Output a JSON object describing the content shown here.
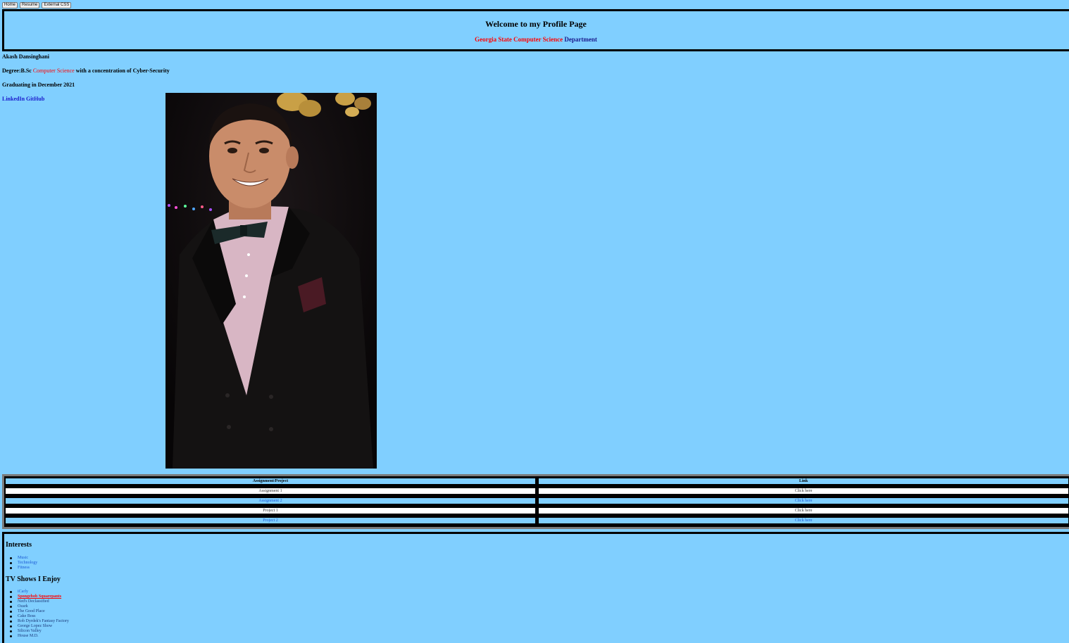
{
  "nav": {
    "home": "Home",
    "resume": "Resume",
    "external_css": "External CSS"
  },
  "header": {
    "title": "Welcome to my Profile Page",
    "dept_red": "Georgia State Computer Science",
    "dept_navy": "Department"
  },
  "profile": {
    "name": "Akash Dansinghani",
    "degree_prefix": "Degree:B.Sc",
    "degree_major": "Computer Science",
    "degree_suffix": "with a concentration of Cyber-Security",
    "graduation": "Graduating in December 2021",
    "link_linkedin": "LinkedIn",
    "link_github": "GitHub"
  },
  "table": {
    "headers": [
      "Assignment/Project",
      "Link"
    ],
    "rows": [
      [
        "Assignment 1",
        "Click here"
      ],
      [
        "Assignment 2",
        "Click here"
      ],
      [
        "Project 1",
        "Click here"
      ],
      [
        "Project 2",
        "Click here"
      ]
    ]
  },
  "interests": {
    "title": "Interests",
    "items": [
      "Music",
      "Technology",
      "Fitness"
    ]
  },
  "tv": {
    "title": "TV Shows I Enjoy",
    "items": [
      "iCarly",
      "Spongebob Squarepants",
      "Ned's Declassified",
      "Ozark",
      "The Good Place",
      "Cake Boss",
      "Rob Dyrdek's Fantasy Factory",
      "George Lopez Show",
      "Silicon Valley",
      "House M.D."
    ]
  },
  "colors": {
    "background": "#80cfff",
    "accent_red": "#ff0000",
    "link_blue": "#1a5ad4"
  }
}
